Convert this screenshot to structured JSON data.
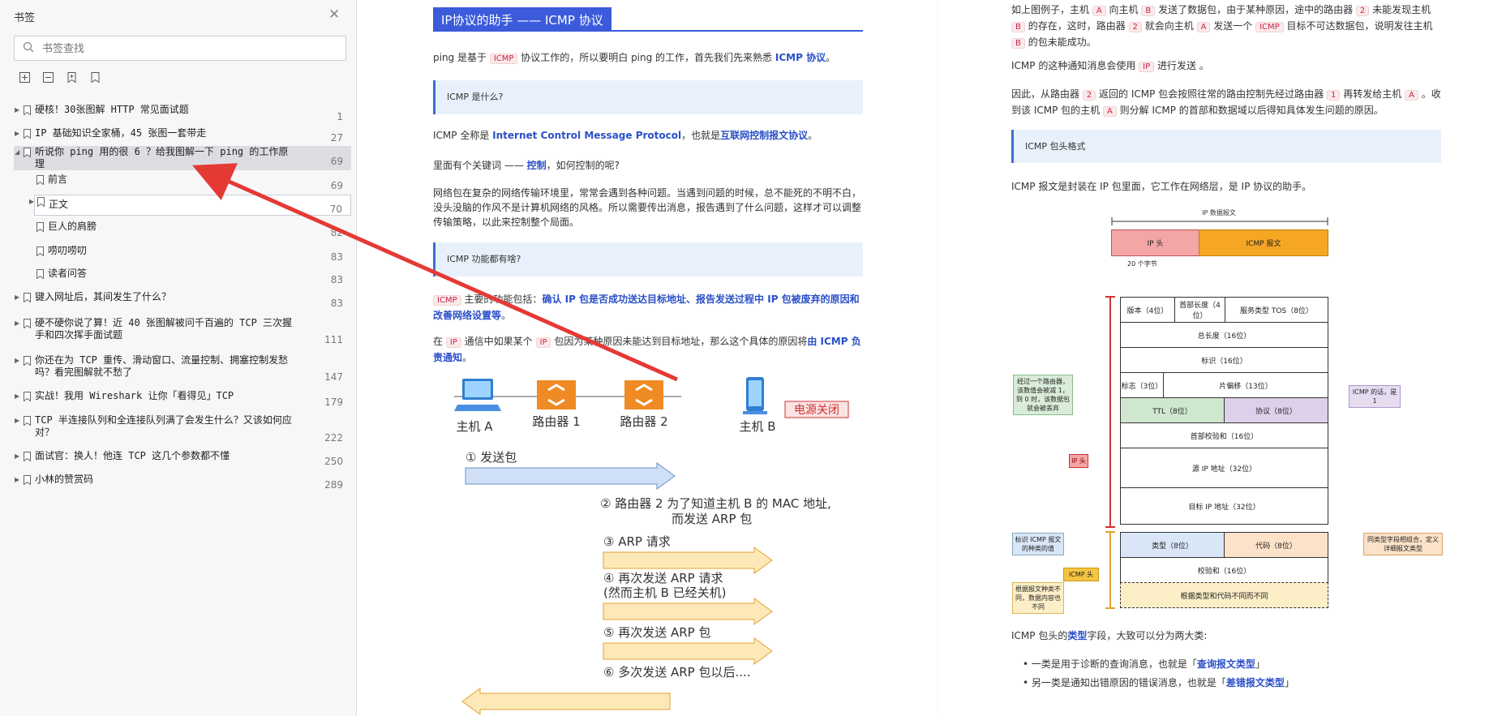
{
  "sidebar": {
    "title": "书签",
    "search_placeholder": "书签查找",
    "bookmarks": [
      {
        "label": "硬核！30张图解 HTTP 常见面试题",
        "page": "1"
      },
      {
        "label": "IP 基础知识全家桶，45 张图一套带走",
        "page": "27"
      },
      {
        "label": "听说你 ping 用的很 6 ？给我图解一下 ping 的工作原理",
        "page": "69"
      },
      {
        "label": "前言",
        "page": "69"
      },
      {
        "label": "正文",
        "page": "70"
      },
      {
        "label": "巨人的肩膀",
        "page": "82"
      },
      {
        "label": "唠叨唠叨",
        "page": "83"
      },
      {
        "label": "读者问答",
        "page": "83"
      },
      {
        "label": "键入网址后，其间发生了什么？",
        "page": "83"
      },
      {
        "label": "硬不硬你说了算！近 40 张图解被问千百遍的 TCP 三次握手和四次挥手面试题",
        "page": "111"
      },
      {
        "label": "你还在为 TCP 重传、滑动窗口、流量控制、拥塞控制发愁吗？看完图解就不愁了",
        "page": "147"
      },
      {
        "label": "实战！我用 Wireshark 让你「看得见」TCP",
        "page": "179"
      },
      {
        "label": "TCP 半连接队列和全连接队列满了会发生什么？又该如何应对？",
        "page": "222"
      },
      {
        "label": "面试官：换人！他连 TCP 这几个参数都不懂",
        "page": "250"
      },
      {
        "label": "小林的赞赏码",
        "page": "289"
      }
    ]
  },
  "mid": {
    "heading": "IP协议的助手 —— ICMP 协议",
    "p1_a": "ping 是基于",
    "p1_code": "ICMP",
    "p1_b": "协议工作的，所以要明白 ping 的工作，首先我们先来熟悉",
    "p1_hl": "ICMP 协议",
    "p1_c": "。",
    "callout1": "ICMP 是什么?",
    "p2_a": "ICMP 全称是",
    "p2_hl1": "Internet Control Message Protocol",
    "p2_b": "，也就是",
    "p2_hl2": "互联网控制报文协议",
    "p2_c": "。",
    "p3_a": "里面有个关键词 ——",
    "p3_hl": "控制",
    "p3_b": "，如何控制的呢?",
    "p4": "网络包在复杂的网络传输环境里，常常会遇到各种问题。当遇到问题的时候，总不能死的不明不白，没头没脑的作风不是计算机网络的风格。所以需要传出消息，报告遇到了什么问题，这样才可以调整传输策略，以此来控制整个局面。",
    "callout2": "ICMP 功能都有啥?",
    "p5_code": "ICMP",
    "p5_a": "主要的功能包括：",
    "p5_hl": "确认 IP 包是否成功送达目标地址、报告发送过程中 IP 包被废弃的原因和改善网络设置等",
    "p5_b": "。",
    "p6_a": "在",
    "p6_code1": "IP",
    "p6_b": "通信中如果某个",
    "p6_code2": "IP",
    "p6_c": "包因为某种原因未能达到目标地址，那么这个具体的原因将",
    "p6_hl": "由 ICMP 负责通知",
    "p6_d": "。",
    "diagram": {
      "host_a": "主机 A",
      "router1": "路由器 1",
      "router2": "路由器 2",
      "host_b": "主机 B",
      "power_off": "电源关闭",
      "step1": "① 发送包",
      "step2a": "② 路由器 2 为了知道主机 B 的 MAC 地址,",
      "step2b": "而发送 ARP 包",
      "step3": "③ ARP 请求",
      "step4a": "④ 再次发送 ARP 请求",
      "step4b": "(然而主机 B 已经关机)",
      "step5": "⑤ 再次发送 ARP 包",
      "step6": "⑥ 多次发送 ARP 包以后...."
    }
  },
  "right": {
    "p1_a": "如上图例子，主机",
    "c_a": "A",
    "p1_b": "向主机",
    "c_b": "B",
    "p1_c": "发送了数据包，由于某种原因，途中的路由器",
    "c_2": "2",
    "p1_d": "未能发现主机",
    "p1_e": "的存在，这时，路由器",
    "p1_f": "就会向主机",
    "p1_g": "发送一个",
    "c_icmp": "ICMP",
    "p1_h": "目标不可达数据包，说明发往主机",
    "p1_i": "的包未能成功。",
    "p2_a": "ICMP 的这种通知消息会使用",
    "c_ip": "IP",
    "p2_b": "进行发送 。",
    "p3_a": "因此，从路由器",
    "p3_b": "返回的 ICMP 包会按照往常的路由控制先经过路由器",
    "c_1": "1",
    "p3_c": "再转发给主机",
    "p3_d": "。收到该 ICMP 包的主机",
    "p3_e": "则分解 ICMP 的首部和数据域以后得知具体发生问题的原因。",
    "callout": "ICMP 包头格式",
    "p4": "ICMP 报文是封装在 IP 包里面，它工作在网络层，是 IP 协议的助手。",
    "diag": {
      "ip_packet": "IP 数据报文",
      "ip_head": "IP 头",
      "icmp_msg": "ICMP 报文",
      "bytes20": "20 个字节",
      "version": "版本（4位）",
      "hdr_len": "首部长度（4位）",
      "tos": "服务类型 TOS（8位）",
      "total_len": "总长度（16位）",
      "ident": "标识（16位）",
      "flags": "标志（3位）",
      "frag": "片偏移（13位）",
      "ttl": "TTL（8位）",
      "proto": "协议（8位）",
      "checksum_h": "首部校验和（16位）",
      "src": "源 IP 地址（32位）",
      "dst": "目标 IP 地址（32位）",
      "type": "类型（8位）",
      "code": "代码（8位）",
      "checksum": "校验和（16位）",
      "body": "根据类型和代码不同而不同",
      "note_ttl": "经过一个路由器，该数值会被减 1，到 0 时，该数据包就会被丢弃",
      "note_proto": "ICMP 的话，是 1",
      "tag_ip": "IP 头",
      "note_type": "标识 ICMP 报文的种类的值",
      "note_code": "同类型字段相组合，定义详细报文类型",
      "tag_icmp": "ICMP 头",
      "note_body": "根据报文种类不同，数据内容也不同"
    },
    "p5_a": "ICMP 包头的",
    "p5_hl": "类型",
    "p5_b": "字段，大致可以分为两大类:",
    "li1_a": "一类是用于诊断的查询消息，也就是「",
    "li1_hl": "查询报文类型",
    "li1_b": "」",
    "li2_a": "另一类是通知出错原因的错误消息，也就是「",
    "li2_hl": "差错报文类型",
    "li2_b": "」"
  }
}
